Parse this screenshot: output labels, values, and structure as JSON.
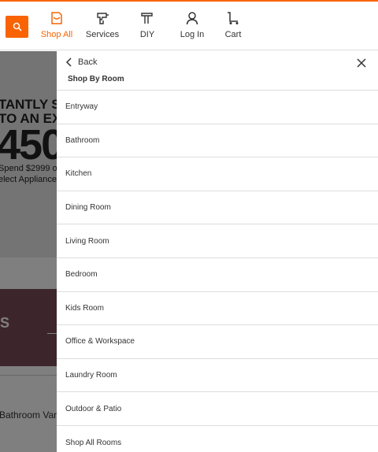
{
  "header": {
    "nav": [
      {
        "label": "Shop All",
        "icon": "shop-all-icon",
        "active": true
      },
      {
        "label": "Services",
        "icon": "services-drill-icon",
        "active": false
      },
      {
        "label": "DIY",
        "icon": "diy-hammer-icon",
        "active": false
      },
      {
        "label": "Log In",
        "icon": "user-icon",
        "active": false
      },
      {
        "label": "Cart",
        "icon": "cart-icon",
        "active": false
      }
    ],
    "search_icon": "search-icon"
  },
  "background": {
    "promo_line1": "TANTLY SA",
    "promo_line2": "TO AN EXT",
    "promo_big": "450",
    "promo_small1": "Spend $2999 o",
    "promo_small2": "elect Appliance",
    "maroon_letter": "S",
    "vanity_text": "Bathroom Van"
  },
  "drawer": {
    "back_label": "Back",
    "title": "Shop By Room",
    "items": [
      "Entryway",
      "Bathroom",
      "Kitchen",
      "Dining Room",
      "Living Room",
      "Bedroom",
      "Kids Room",
      "Office & Workspace",
      "Laundry Room",
      "Outdoor & Patio",
      "Shop All Rooms"
    ]
  },
  "colors": {
    "brand_orange": "#f96302",
    "maroon_banner": "#7b4a59"
  }
}
